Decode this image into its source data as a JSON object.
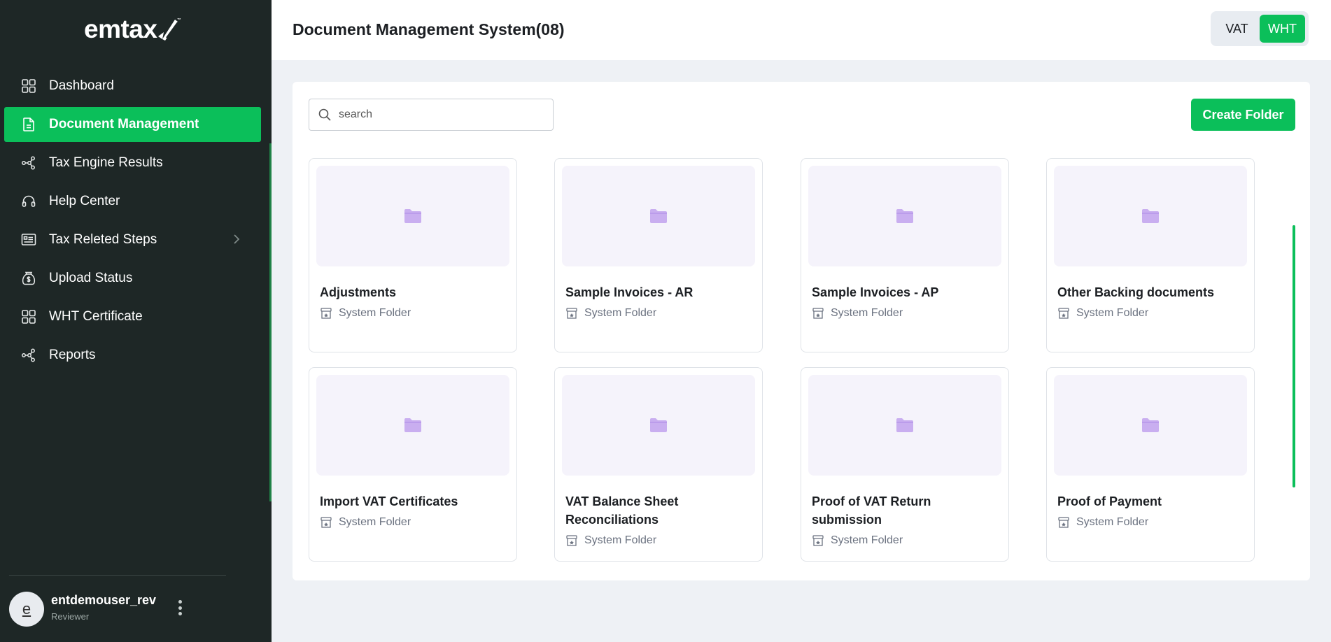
{
  "app": {
    "logo_text": "emtax"
  },
  "sidebar": {
    "items": [
      {
        "label": "Dashboard",
        "icon": "grid-icon",
        "active": false
      },
      {
        "label": "Document Management",
        "icon": "document-icon",
        "active": true
      },
      {
        "label": "Tax Engine Results",
        "icon": "network-icon",
        "active": false
      },
      {
        "label": "Help Center",
        "icon": "headset-icon",
        "active": false
      },
      {
        "label": "Tax Releted Steps",
        "icon": "list-icon",
        "active": false,
        "has_submenu": true
      },
      {
        "label": "Upload Status",
        "icon": "money-bag-icon",
        "active": false
      },
      {
        "label": "WHT Certificate",
        "icon": "grid-icon",
        "active": false
      },
      {
        "label": "Reports",
        "icon": "network-icon",
        "active": false
      }
    ],
    "user": {
      "initial": "e",
      "name": "entdemouser_rev",
      "role": "Reviewer"
    }
  },
  "header": {
    "title": "Document Management System(08)",
    "toggle": {
      "options": [
        "VAT",
        "WHT"
      ],
      "selected": "WHT"
    }
  },
  "main": {
    "search": {
      "placeholder": "search",
      "value": ""
    },
    "create_button": "Create Folder",
    "folders": [
      {
        "name": "Adjustments",
        "type": "System Folder"
      },
      {
        "name": "Sample Invoices - AR",
        "type": "System Folder"
      },
      {
        "name": "Sample Invoices - AP",
        "type": "System Folder"
      },
      {
        "name": "Other Backing documents",
        "type": "System Folder"
      },
      {
        "name": "Import VAT Certificates",
        "type": "System Folder"
      },
      {
        "name": "VAT Balance Sheet Reconciliations",
        "type": "System Folder"
      },
      {
        "name": "Proof of VAT Return submission",
        "type": "System Folder"
      },
      {
        "name": "Proof of Payment",
        "type": "System Folder"
      }
    ]
  },
  "colors": {
    "sidebar_bg": "#1e2726",
    "accent_green": "#0bbf5a",
    "folder_icon": "#c9aef0",
    "thumb_bg": "#f5f3fb",
    "page_bg": "#eef1f5"
  }
}
